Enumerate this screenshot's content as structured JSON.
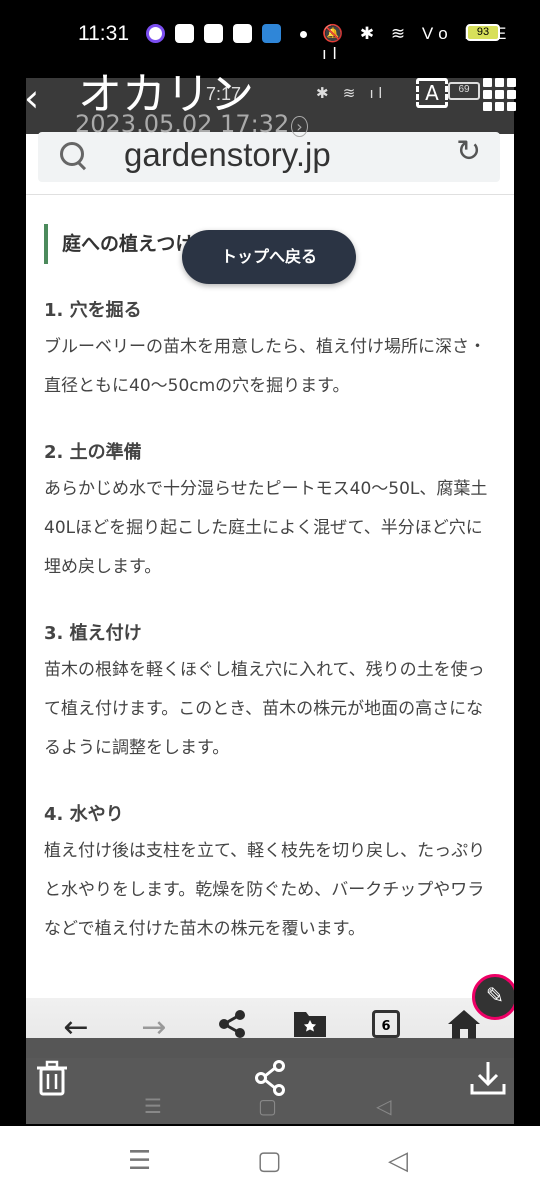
{
  "status_bar": {
    "time": "11:31",
    "system_icons": "🔕 ✱ ≋ Vo LTE ıl",
    "battery": "93"
  },
  "viewer": {
    "sender": "オカリン",
    "timestamp": "2023.05.02 17:32",
    "timestamp_chevron": "›",
    "back_icon": "‹",
    "ocr_label": "A"
  },
  "embedded_status": {
    "time": "7:17",
    "icons": "✱ ≋ ıl",
    "battery": "69"
  },
  "browser": {
    "url": "gardenstory.jp",
    "reload_icon": "↻",
    "tab_count": "6"
  },
  "article": {
    "section_heading": "庭への植えつけ",
    "steps": [
      {
        "title": "1. 穴を掘る",
        "body": "ブルーベリーの苗木を用意したら、植え付け場所に深さ・直径ともに40〜50cmの穴を掘ります。"
      },
      {
        "title": "2. 土の準備",
        "body": "あらかじめ水で十分湿らせたピートモス40〜50L、腐葉土40Lほどを掘り起こした庭土によく混ぜて、半分ほど穴に埋め戻します。"
      },
      {
        "title": "3. 植え付け",
        "body": "苗木の根鉢を軽くほぐし植え穴に入れて、残りの土を使って植え付けます。このとき、苗木の株元が地面の高さになるように調整をします。"
      },
      {
        "title": "4. 水やり",
        "body": "植え付け後は支柱を立て、軽く枝先を切り戻し、たっぷりと水やりをします。乾燥を防ぐため、バークチップやワラなどで植え付けた苗木の株元を覆います。"
      }
    ]
  },
  "scroll_to_top": "トップへ戻る",
  "toolbar_icons": {
    "back": "←",
    "forward": "→",
    "share": "share-icon",
    "bookmark": "bookmark-icon",
    "tabs": "tabs-icon",
    "home": "home-icon"
  },
  "system_nav": {
    "recents": "☰",
    "home": "▢",
    "back": "◁"
  }
}
